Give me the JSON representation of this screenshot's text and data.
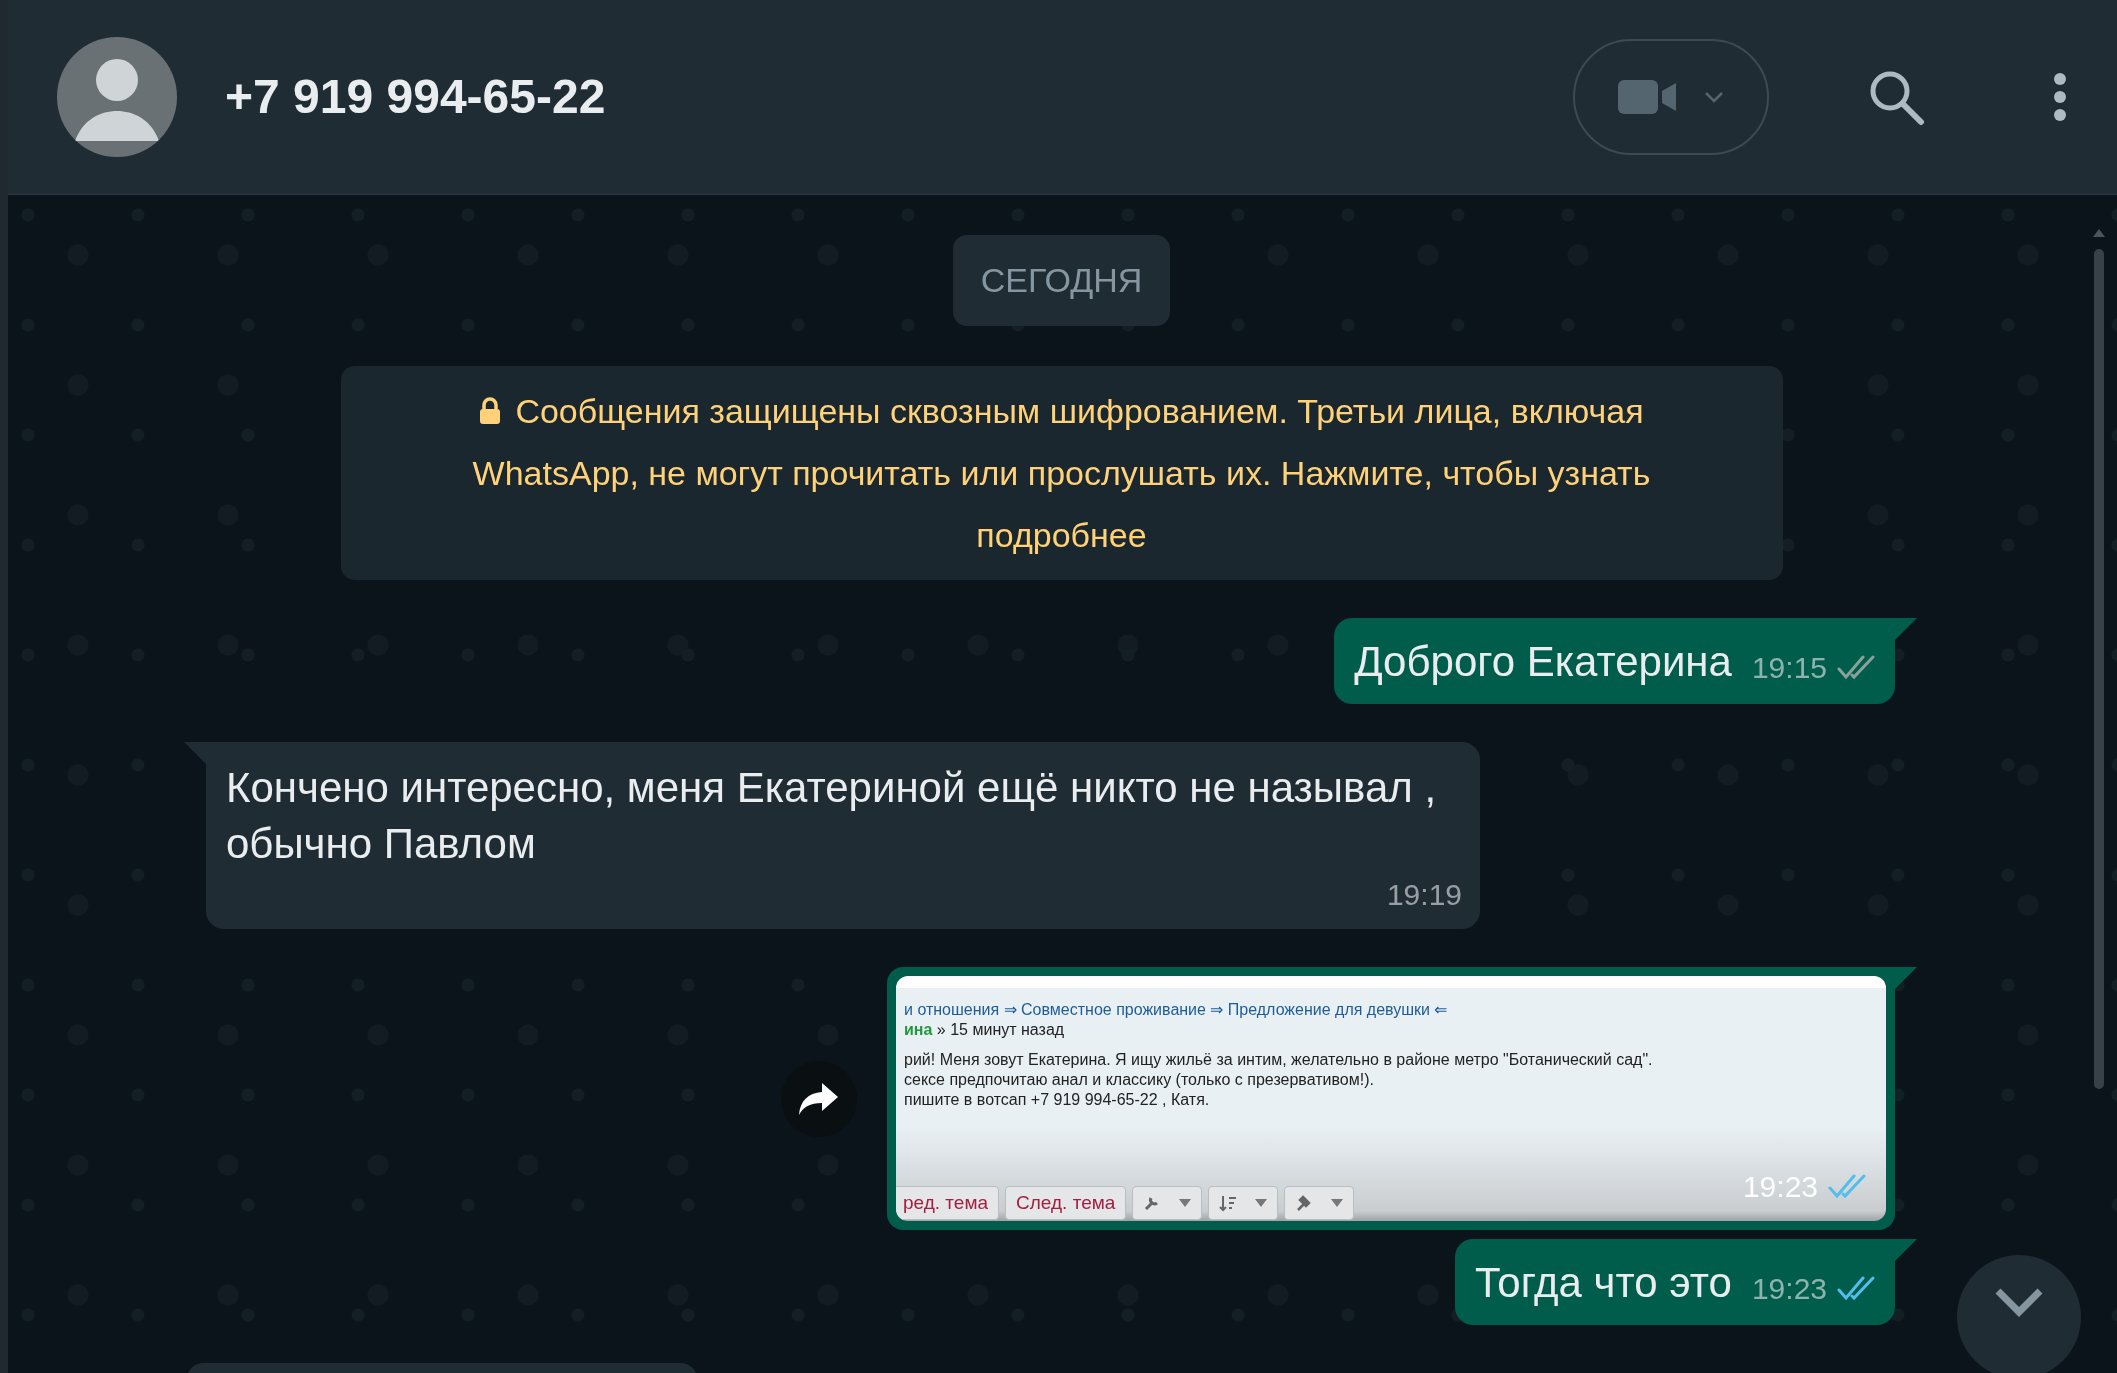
{
  "header": {
    "title": "+7 919 994-65-22"
  },
  "date_chip": "СЕГОДНЯ",
  "encryption_notice": "Сообщения защищены сквозным шифрованием. Третьи лица, включая WhatsApp, не могут прочитать или прослушать их. Нажмите, чтобы узнать подробнее",
  "messages": [
    {
      "kind": "text",
      "outgoing": true,
      "text": "Доброго Екатерина",
      "time": "19:15",
      "read": false
    },
    {
      "kind": "text",
      "outgoing": false,
      "text": "Кончено интересно, меня Екатериной ещё никто не называл , обычно Павлом",
      "time": "19:19"
    },
    {
      "kind": "image",
      "outgoing": true,
      "time": "19:23",
      "read": true,
      "forward": true,
      "screenshot": {
        "breadcrumb": "и отношения ⇒ Совместное проживание ⇒ Предложение для девушки ⇐",
        "author": "ина",
        "meta": "» 15 минут назад",
        "lines": [
          "рий! Меня зовут Екатерина. Я ищу жильё за интим, желательно в районе метро \"Ботанический сад\".",
          "сексе предпочитаю анал и классику (только с презервативом!).",
          "пишите в вотсап +7 919 994-65-22 , Катя."
        ],
        "buttons": [
          {
            "kind": "text",
            "label": "ред. тема"
          },
          {
            "kind": "text",
            "label": "След. тема"
          },
          {
            "kind": "wrench"
          },
          {
            "kind": "sort"
          },
          {
            "kind": "gavel"
          }
        ]
      }
    },
    {
      "kind": "text",
      "outgoing": true,
      "text": "Тогда что это",
      "time": "19:23",
      "read": true
    },
    {
      "kind": "partial",
      "outgoing": false
    }
  ]
}
